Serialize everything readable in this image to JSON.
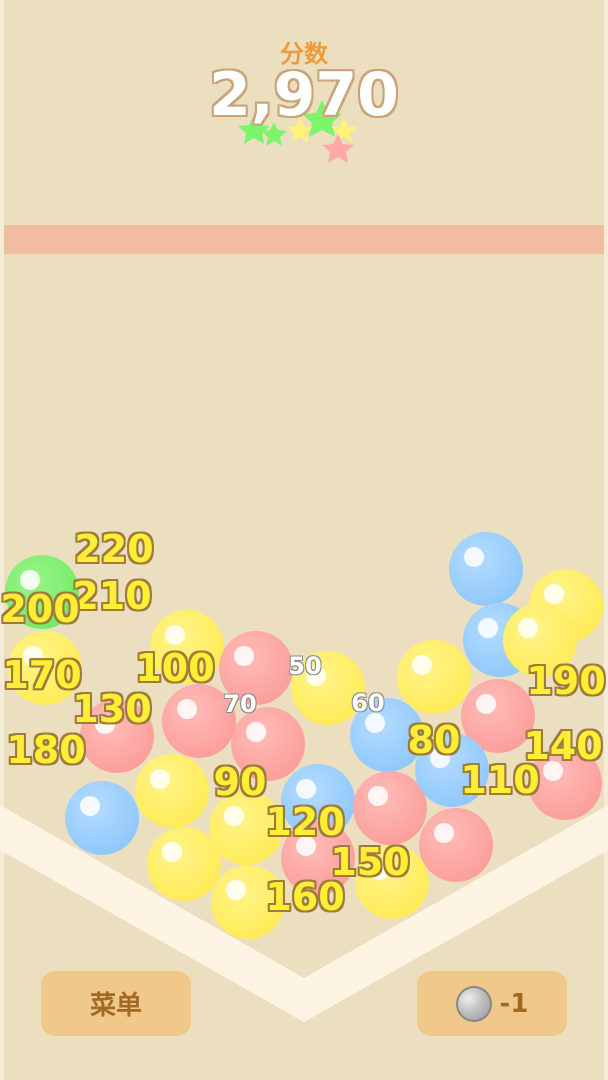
{
  "header": {
    "score_label": "分数",
    "score_value": "2,970"
  },
  "buttons": {
    "menu_label": "菜单",
    "bomb_count": "-1"
  },
  "colors": {
    "background": "#ecdfc0",
    "limit_line": "#f2bca0",
    "funnel": "#fdf4e3",
    "ball_blue": "#9dd0ff",
    "ball_yellow": "#fff06a",
    "ball_pink": "#ffaaa6",
    "ball_green": "#86f27a",
    "label_yellow": "#ffee33"
  },
  "balls": [
    {
      "color": "green"
    },
    {
      "color": "blue"
    },
    {
      "color": "yellow"
    },
    {
      "color": "yellow"
    },
    {
      "color": "yellow"
    },
    {
      "color": "pink"
    },
    {
      "color": "yellow"
    },
    {
      "color": "blue"
    },
    {
      "color": "yellow"
    },
    {
      "color": "pink"
    },
    {
      "color": "pink"
    },
    {
      "color": "blue"
    },
    {
      "color": "pink"
    },
    {
      "color": "yellow"
    },
    {
      "color": "pink"
    },
    {
      "color": "pink"
    },
    {
      "color": "blue"
    },
    {
      "color": "yellow"
    },
    {
      "color": "blue"
    },
    {
      "color": "pink"
    },
    {
      "color": "blue"
    },
    {
      "color": "yellow"
    },
    {
      "color": "yellow"
    },
    {
      "color": "pink"
    },
    {
      "color": "pink"
    },
    {
      "color": "yellow"
    },
    {
      "color": "yellow"
    }
  ],
  "score_popups": [
    {
      "text": "220",
      "style": "big"
    },
    {
      "text": "210",
      "style": "big"
    },
    {
      "text": "200",
      "style": "big"
    },
    {
      "text": "170",
      "style": "big"
    },
    {
      "text": "100",
      "style": "big"
    },
    {
      "text": "50",
      "style": "small"
    },
    {
      "text": "190",
      "style": "big"
    },
    {
      "text": "70",
      "style": "small"
    },
    {
      "text": "60",
      "style": "small"
    },
    {
      "text": "130",
      "style": "big"
    },
    {
      "text": "80",
      "style": "big"
    },
    {
      "text": "140",
      "style": "big"
    },
    {
      "text": "180",
      "style": "big"
    },
    {
      "text": "110",
      "style": "big"
    },
    {
      "text": "90",
      "style": "big"
    },
    {
      "text": "120",
      "style": "big"
    },
    {
      "text": "150",
      "style": "big"
    },
    {
      "text": "160",
      "style": "big"
    }
  ]
}
